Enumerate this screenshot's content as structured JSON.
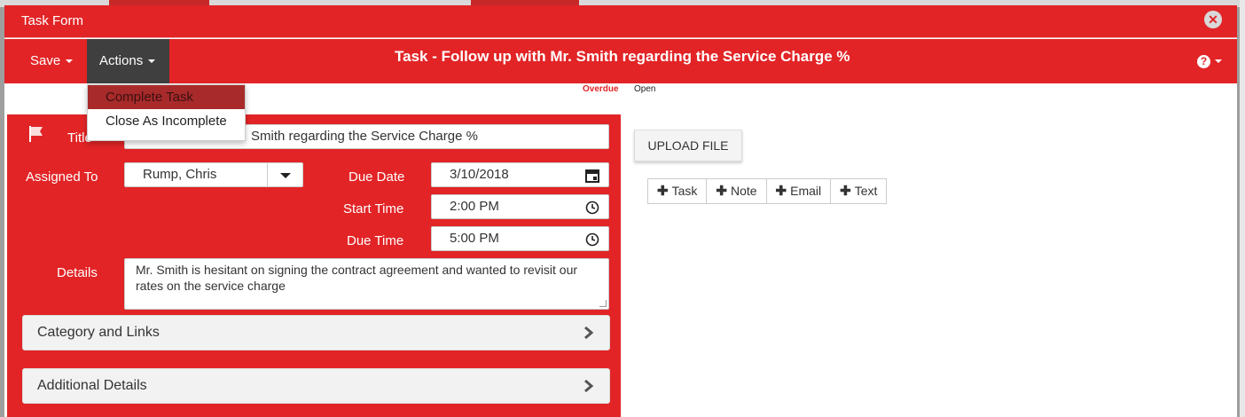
{
  "modal": {
    "title": "Task Form",
    "close_symbol": "✕"
  },
  "toolbar": {
    "save_label": "Save",
    "actions_label": "Actions",
    "heading": "Task - Follow up with Mr. Smith regarding the Service Charge %",
    "help_symbol": "?"
  },
  "actions_menu": {
    "items": [
      {
        "label": "Complete Task",
        "highlighted": true
      },
      {
        "label": "Close As Incomplete",
        "highlighted": false
      }
    ]
  },
  "status": {
    "overdue": "Overdue",
    "state": "Open"
  },
  "form": {
    "title_label": "Title",
    "title_value": "Smith regarding the Service Charge %",
    "assigned_label": "Assigned To",
    "assigned_value": "Rump, Chris",
    "due_date_label": "Due Date",
    "due_date_value": "3/10/2018",
    "start_time_label": "Start Time",
    "start_time_value": "2:00 PM",
    "due_time_label": "Due Time",
    "due_time_value": "5:00 PM",
    "details_label": "Details",
    "details_value": "Mr. Smith is hesitant on signing the contract agreement and wanted to revisit our rates on the service charge"
  },
  "sections": {
    "category": "Category and Links",
    "additional": "Additional Details"
  },
  "attachments": {
    "upload_label": "UPLOAD FILE",
    "add_buttons": [
      "Task",
      "Note",
      "Email",
      "Text"
    ],
    "add_symbol": "✚"
  },
  "colors": {
    "brand_red": "#e22426",
    "active_menu": "#a92a2a",
    "actions_bg": "#3f3f3f"
  },
  "icons": [
    "close-icon",
    "caret-down-icon",
    "help-icon",
    "flag-icon",
    "calendar-icon",
    "clock-icon",
    "chevron-right-icon",
    "plus-icon"
  ]
}
